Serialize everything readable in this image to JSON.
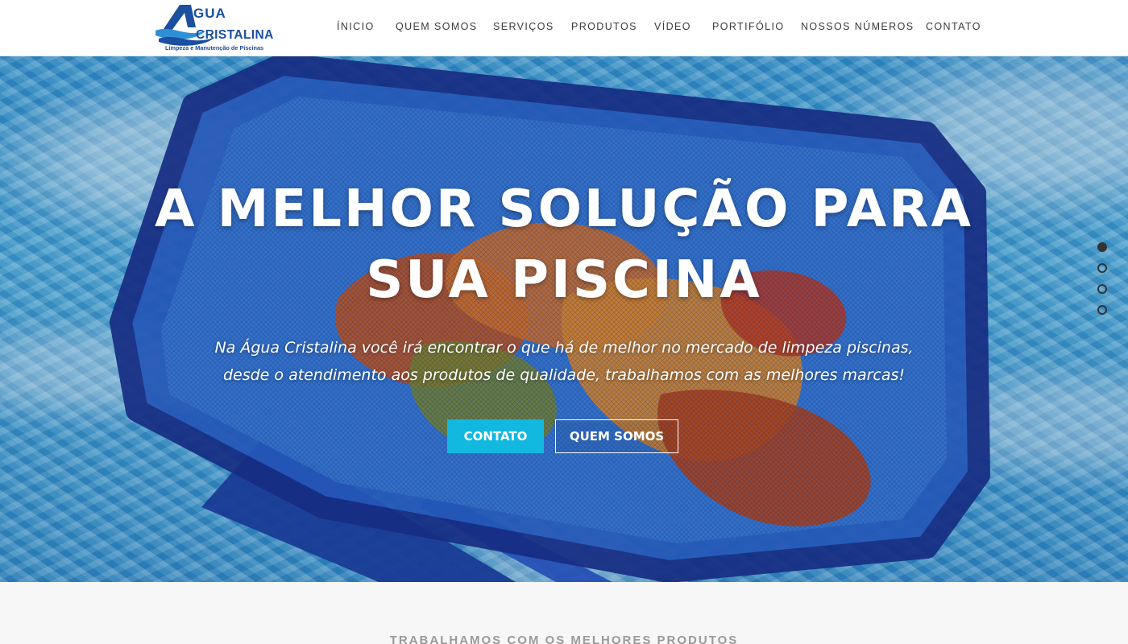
{
  "logo": {
    "word_top": "GUA",
    "word_main": "CRISTALINA",
    "tagline": "Limpeza e Manutenção de Piscinas"
  },
  "nav": {
    "items": [
      {
        "label": "ÍNICIO"
      },
      {
        "label": "QUEM SOMOS"
      },
      {
        "label": "SERVIÇOS"
      },
      {
        "label": "PRODUTOS"
      },
      {
        "label": "VÍDEO"
      },
      {
        "label": "PORTIFÓLIO"
      },
      {
        "label": "NOSSOS NÚMEROS"
      },
      {
        "label": "CONTATO"
      }
    ]
  },
  "hero": {
    "title_line1": "A MELHOR SOLUÇÃO PARA",
    "title_line2": "SUA PISCINA",
    "subtitle_line1": "Na Água Cristalina você irá encontrar o que há de melhor no mercado de limpeza piscinas,",
    "subtitle_line2": "desde o atendimento aos produtos de qualidade, trabalhamos com as melhores marcas!",
    "buttons": {
      "contato": "CONTATO",
      "quem_somos": "QUEM SOMOS"
    },
    "slider": {
      "count": 4,
      "active_index": 0
    }
  },
  "section": {
    "heading": "TRABALHAMOS COM OS MELHORES PRODUTOS"
  },
  "colors": {
    "accent": "#12b8e0",
    "logo_blue": "#1b4fa0",
    "header_bg": "#ffffff",
    "nav_text": "#3a3a3a",
    "section_bg": "#f7f7f7"
  }
}
